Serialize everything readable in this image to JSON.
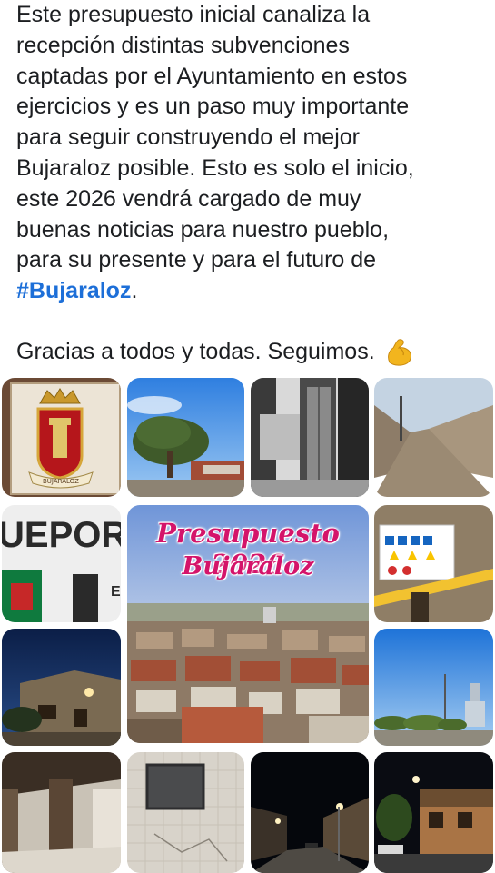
{
  "post": {
    "lines": [
      "Este presupuesto inicial canaliza la",
      "recepción distintas subvenciones",
      "captadas por el Ayuntamiento en estos",
      "ejercicios y es un paso muy importante",
      "para seguir construyendo el mejor",
      "Bujaraloz posible. Esto es solo el inicio,",
      "este 2026 vendrá cargado de muy",
      "buenas noticias para nuestro pueblo,",
      "para su presente y para el futuro de"
    ],
    "hashtag": "#Bujaraloz",
    "hashtag_suffix": ".",
    "thanks": "Gracias a todos y todas. Seguimos.",
    "thanks_emoji": "flexed-biceps-icon"
  },
  "collage": {
    "headline_line1": "Presupuesto 2026",
    "headline_line2": "Bujaraloz",
    "sign_text": "UEPOR",
    "sign_letter": "E",
    "crest_ribbon": "BUJARALOZ",
    "accent_color": "#d4146a"
  }
}
